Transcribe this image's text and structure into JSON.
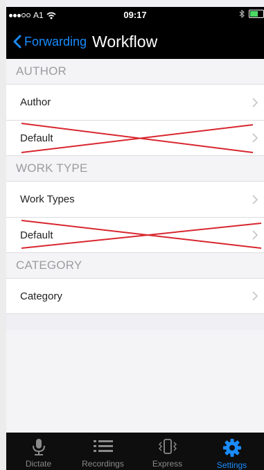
{
  "status_bar": {
    "carrier": "A1",
    "time": "09:17"
  },
  "nav": {
    "back_label": "Forwarding",
    "title": "Workflow"
  },
  "sections": [
    {
      "header": "AUTHOR",
      "rows": [
        {
          "label": "Author",
          "struck": false
        },
        {
          "label": "Default",
          "struck": true
        }
      ]
    },
    {
      "header": "WORK TYPE",
      "rows": [
        {
          "label": "Work Types",
          "struck": false
        },
        {
          "label": "Default",
          "struck": true
        }
      ]
    },
    {
      "header": "CATEGORY",
      "rows": [
        {
          "label": "Category",
          "struck": false
        }
      ]
    }
  ],
  "tabs": [
    {
      "label": "Dictate",
      "icon": "microphone-icon",
      "active": false
    },
    {
      "label": "Recordings",
      "icon": "list-icon",
      "active": false
    },
    {
      "label": "Express",
      "icon": "vibrating-phone-icon",
      "active": false
    },
    {
      "label": "Settings",
      "icon": "gear-icon",
      "active": true
    }
  ],
  "colors": {
    "accent": "#1a8cff",
    "strike": "#d8262e",
    "nav_background": "#000000"
  }
}
